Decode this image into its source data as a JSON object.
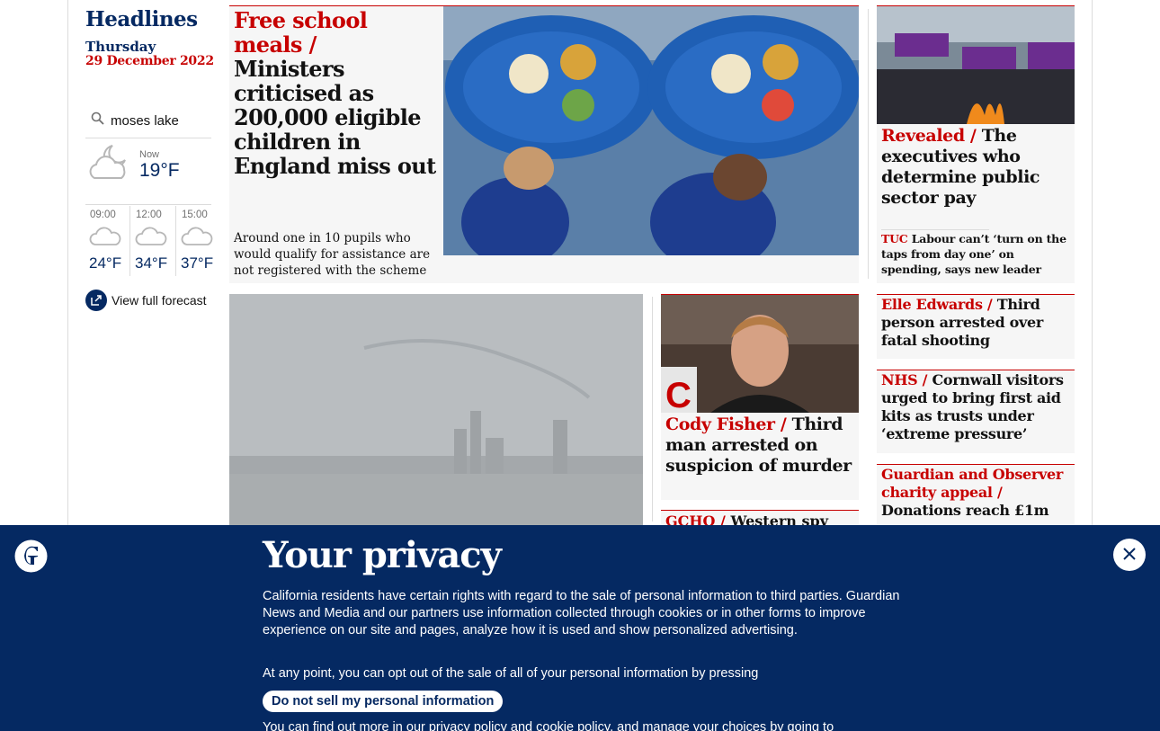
{
  "sidebar": {
    "title": "Headlines",
    "day": "Thursday",
    "date": "29 December 2022",
    "location": "moses lake",
    "now_label": "Now",
    "now_temp": "19°F",
    "forecast": [
      {
        "time": "09:00",
        "temp": "24°F",
        "icon": "cloud-icon"
      },
      {
        "time": "12:00",
        "temp": "34°F",
        "icon": "cloud-icon"
      },
      {
        "time": "15:00",
        "temp": "37°F",
        "icon": "cloud-icon"
      }
    ],
    "full_forecast": "View full forecast"
  },
  "lead": {
    "kicker": "Free school meals /",
    "headline": "Ministers criticised as 200,000 eligible children in England miss out",
    "standfirst": "Around one in 10 pupils who would qualify for assistance are not registered with the scheme"
  },
  "revealed": {
    "kicker": "Revealed /",
    "headline": "The executives who determine public sector pay",
    "sub_kicker": "TUC",
    "sub_headline": "Labour can’t ‘turn on the taps from day one’ on spending, says new leader"
  },
  "cards": [
    {
      "kicker": "Elle Edwards /",
      "headline": "Third person arrested over fatal shooting"
    },
    {
      "kicker": "NHS /",
      "headline": "Cornwall visitors urged to bring first aid kits as trusts under ‘extreme pressure’"
    },
    {
      "kicker": "Guardian and Observer charity appeal /",
      "headline": "Donations reach £1m"
    }
  ],
  "cody": {
    "kicker": "Cody Fisher /",
    "headline": "Third man arrested on suspicion of murder"
  },
  "gchq": {
    "kicker": "GCHQ /",
    "headline": "Western spy"
  },
  "consent": {
    "title": "Your privacy",
    "p1": "California residents have certain rights with regard to the sale of personal information to third parties. Guardian News and Media and our partners use information collected through cookies or in other forms to improve experience on our site and pages, analyze how it is used and show personalized advertising.",
    "p2": "At any point, you can opt out of the sale of all of your personal information by pressing",
    "button": "Do not sell my personal information",
    "p3": "You can find out more in our privacy policy and cookie policy, and manage your choices by going to"
  },
  "colors": {
    "brand": "#052962",
    "kicker": "#c70000",
    "card_bg": "#f6f6f6"
  }
}
